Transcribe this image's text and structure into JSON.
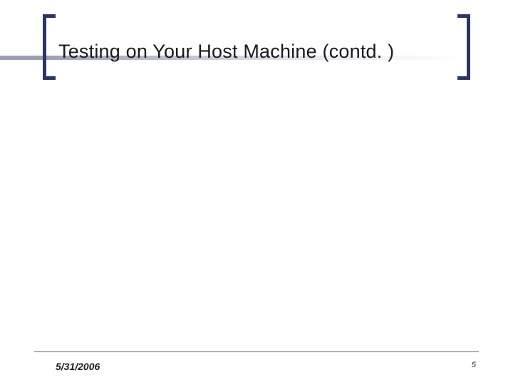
{
  "header": {
    "title": "Testing on Your Host Machine (contd. )"
  },
  "footer": {
    "date": "5/31/2006",
    "page": "5"
  },
  "theme": {
    "accent": "#2a3563"
  }
}
